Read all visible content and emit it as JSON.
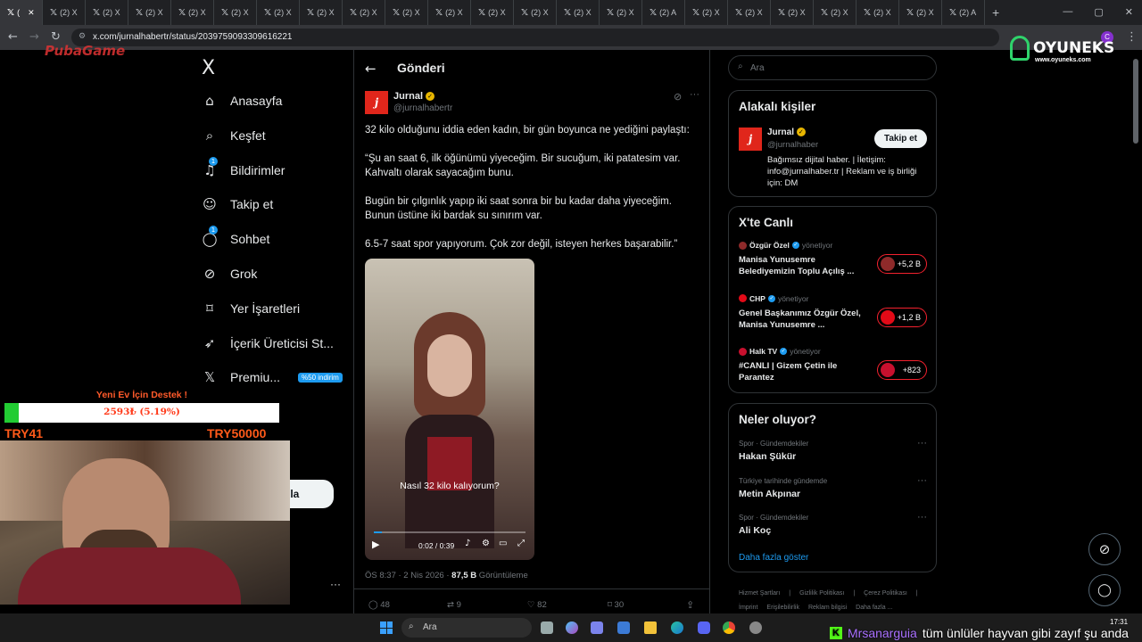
{
  "browser": {
    "tabs": [
      {
        "label": "(",
        "active": true
      },
      {
        "label": "(2) X"
      },
      {
        "label": "(2) X"
      },
      {
        "label": "(2) X"
      },
      {
        "label": "(2) X"
      },
      {
        "label": "(2) X"
      },
      {
        "label": "(2) X"
      },
      {
        "label": "(2) X"
      },
      {
        "label": "(2) X"
      },
      {
        "label": "(2) X"
      },
      {
        "label": "(2) X"
      },
      {
        "label": "(2) X"
      },
      {
        "label": "(2) X"
      },
      {
        "label": "(2) X"
      },
      {
        "label": "(2) X"
      },
      {
        "label": "(2) A"
      },
      {
        "label": "(2) X"
      },
      {
        "label": "(2) X"
      },
      {
        "label": "(2) X"
      },
      {
        "label": "(2) X"
      },
      {
        "label": "(2) X"
      },
      {
        "label": "(2) X"
      },
      {
        "label": "(2) A"
      }
    ],
    "new_tab": "+",
    "url": "x.com/jurnalhabertr/status/2039759093309616221",
    "profile_initial": "C"
  },
  "overlay": {
    "brand_left": "PubaGame",
    "oyuneks_title": "OYUNEKS",
    "oyuneks_url": "www.oyuneks.com",
    "donation_title": "Yeni Ev İçin Destek !",
    "donation_progress_text": "2593₺ (5.19%)",
    "donation_progress": 0.0519,
    "donation_min": "TRY41",
    "donation_max": "TRY50000",
    "chat_user": "Mrsanarguia",
    "chat_text": "tüm ünlüler hayvan gibi zayıf şu anda"
  },
  "sidebar": {
    "logo": "X",
    "items": [
      {
        "label": "Anasayfa",
        "icon": "home-icon"
      },
      {
        "label": "Keşfet",
        "icon": "search-icon"
      },
      {
        "label": "Bildirimler",
        "icon": "bell-icon",
        "badge": "1"
      },
      {
        "label": "Takip et",
        "icon": "follow-icon"
      },
      {
        "label": "Sohbet",
        "icon": "chat-icon",
        "badge": "1"
      },
      {
        "label": "Grok",
        "icon": "grok-icon"
      },
      {
        "label": "Yer İşaretleri",
        "icon": "bookmark-icon"
      },
      {
        "label": "İçerik Üreticisi St...",
        "icon": "rocket-icon"
      },
      {
        "label": "Premiu...",
        "icon": "x-icon"
      }
    ],
    "premium_badge": "%50 indirim",
    "post_button_partial": "nla",
    "more": "···"
  },
  "post": {
    "header_title": "Gönderi",
    "author_name": "Jurnal",
    "author_handle": "@jurnalhabertr",
    "paragraphs": [
      "32 kilo olduğunu iddia eden kadın, bir gün boyunca ne yediğini paylaştı:",
      "“Şu an saat 6, ilk öğünümü yiyeceğim. Bir sucuğum, iki patatesim var.",
      "Kahvaltı olarak sayacağım bunu.",
      "Bugün bir çılgınlık yapıp iki saat sonra bir bu kadar daha yiyeceğim.",
      "Bunun üstüne iki bardak su sınırım var.",
      "6.5-7 saat spor yapıyorum. Çok zor değil, isteyen herkes başarabilir.”"
    ],
    "video_caption": "Nasıl 32 kilo kalıyorum?",
    "video_time": "0:02 / 0:39",
    "video_progress": 0.05,
    "meta_time": "ÖS 8:37 · 2 Nis 2026 · ",
    "meta_views": "87,5 B",
    "meta_views_label": " Görüntüleme",
    "actions": {
      "replies": "48",
      "reposts": "9",
      "likes": "82",
      "bookmarks": "30"
    }
  },
  "right": {
    "search_placeholder": "Ara",
    "related_title": "Alakalı kişiler",
    "related": {
      "name": "Jurnal",
      "handle": "@jurnalhaber",
      "follow": "Takip et",
      "bio_lines": [
        "Bağımsız dijital haber. | İletişim:",
        "info@jurnalhaber.tr | Reklam ve iş birliği",
        "için: DM"
      ]
    },
    "live_title": "X'te Canlı",
    "live": [
      {
        "host": "Özgür Özel",
        "role": "yönetiyor",
        "title1": "Manisa Yunusemre",
        "title2": "Belediyemizin Toplu Açılış ...",
        "count": "+5,2 B"
      },
      {
        "host": "CHP",
        "role": "yönetiyor",
        "title1": "Genel Başkanımız Özgür Özel,",
        "title2": "Manisa Yunusemre ...",
        "count": "+1,2 B"
      },
      {
        "host": "Halk TV",
        "role": "yönetiyor",
        "title1": "#CANLI | Gizem Çetin ile",
        "title2": "Parantez",
        "count": "+823"
      }
    ],
    "trends_title": "Neler oluyor?",
    "trends": [
      {
        "category": "Spor · Gündemdekiler",
        "name": "Hakan Şükür"
      },
      {
        "category": "Türkiye tarihinde gündemde",
        "name": "Metin Akpınar"
      },
      {
        "category": "Spor · Gündemdekiler",
        "name": "Ali Koç"
      }
    ],
    "show_more": "Daha fazla göster",
    "footer_line1": [
      "Hizmet Şartları",
      "|",
      "Gizlilik Politikası",
      "|",
      "Çerez Politikası",
      "|"
    ],
    "footer_line2": [
      "İmprint",
      "Erişilebilirlik",
      "Reklam bilgisi",
      "Daha fazla ..."
    ]
  },
  "taskbar": {
    "search_placeholder": "Ara",
    "time": "17:31"
  },
  "colors": {
    "accent": "#1d9bf0",
    "brand_red": "#e0261b",
    "live_red": "#f4212e"
  }
}
